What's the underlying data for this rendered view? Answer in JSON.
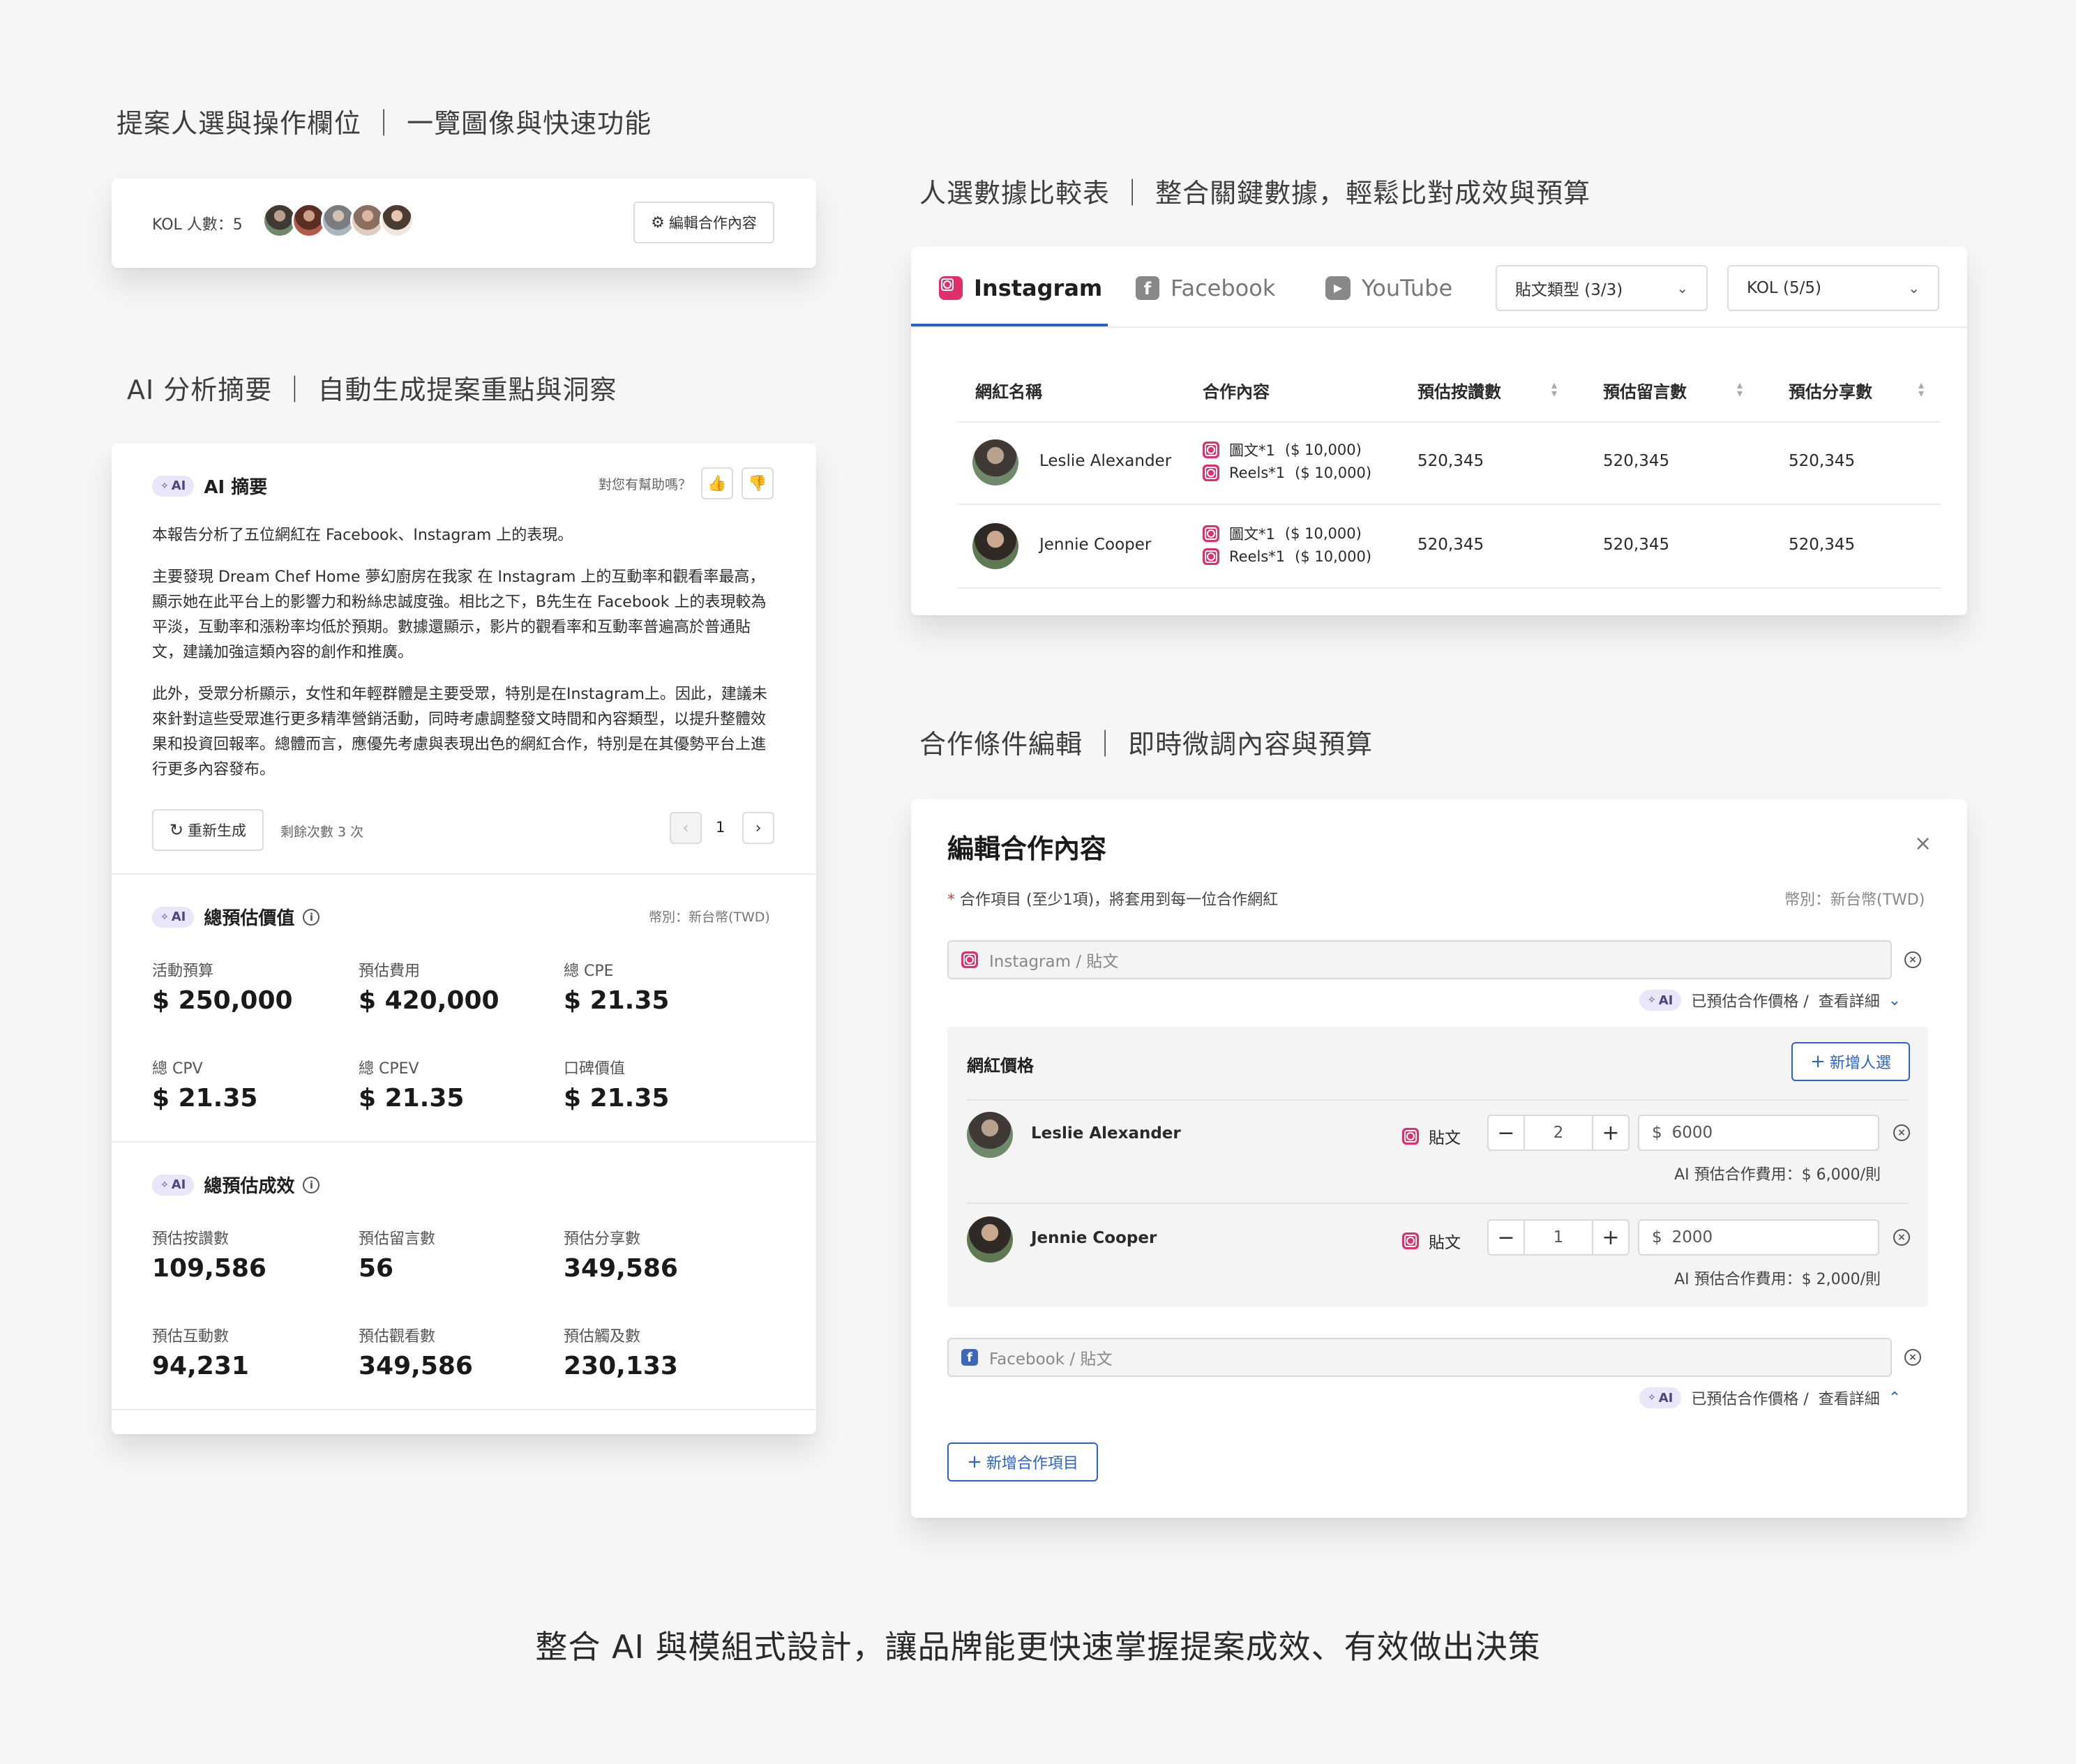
{
  "headings": {
    "kol": "提案人選與操作欄位 ｜ 一覽圖像與快速功能",
    "ai": "AI 分析摘要 ｜ 自動生成提案重點與洞察",
    "compare": "人選數據比較表 ｜ 整合關鍵數據，輕鬆比對成效與預算",
    "edit": "合作條件編輯 ｜ 即時微調內容與預算",
    "footer": "整合 AI 與模組式設計，讓品牌能更快速掌握提案成效、有效做出決策"
  },
  "kol_bar": {
    "count_label": "KOL 人數：5",
    "edit_button": "編輯合作內容"
  },
  "ai_summary": {
    "badge": "AI",
    "title": "AI 摘要",
    "helpful": "對您有幫助嗎？",
    "p1": "本報告分析了五位網紅在 Facebook、Instagram 上的表現。",
    "p2": "主要發現 Dream Chef Home 夢幻廚房在我家 在 Instagram 上的互動率和觀看率最高，顯示她在此平台上的影響力和粉絲忠誠度強。相比之下，B先生在 Facebook 上的表現較為平淡，互動率和漲粉率均低於預期。數據還顯示，影片的觀看率和互動率普遍高於普通貼文，建議加強這類內容的創作和推廣。",
    "p3": "此外，受眾分析顯示，女性和年輕群體是主要受眾，特別是在Instagram上。因此，建議未來針對這些受眾進行更多精準營銷活動，同時考慮調整發文時間和內容類型，以提升整體效果和投資回報率。總體而言，應優先考慮與表現出色的網紅合作，特別是在其優勢平台上進行更多內容發布。",
    "regen": "重新生成",
    "remaining": "剩餘次數 3 次",
    "page": "1"
  },
  "total_value": {
    "badge": "AI",
    "title": "總預估價值",
    "currency": "幣別：新台幣(TWD)",
    "items": [
      {
        "label": "活動預算",
        "value": "$ 250,000"
      },
      {
        "label": "預估費用",
        "value": "$ 420,000"
      },
      {
        "label": "總 CPE",
        "value": "$ 21.35"
      },
      {
        "label": "總 CPV",
        "value": "$ 21.35"
      },
      {
        "label": "總 CPEV",
        "value": "$ 21.35"
      },
      {
        "label": "口碑價值",
        "value": "$ 21.35"
      }
    ]
  },
  "total_effect": {
    "badge": "AI",
    "title": "總預估成效",
    "items": [
      {
        "label": "預估按讚數",
        "value": "109,586"
      },
      {
        "label": "預估留言數",
        "value": "56"
      },
      {
        "label": "預估分享數",
        "value": "349,586"
      },
      {
        "label": "預估互動數",
        "value": "94,231"
      },
      {
        "label": "預估觀看數",
        "value": "349,586"
      },
      {
        "label": "預估觸及數",
        "value": "230,133"
      }
    ]
  },
  "compare": {
    "tabs": [
      "Instagram",
      "Facebook",
      "YouTube"
    ],
    "filter_type": "貼文類型 (3/3)",
    "filter_kol": "KOL  (5/5)",
    "columns": [
      "網紅名稱",
      "合作內容",
      "預估按讚數",
      "預估留言數",
      "預估分享數"
    ],
    "rows": [
      {
        "name": "Leslie Alexander",
        "c1": "圖文*1",
        "p1": "($ 10,000)",
        "c2": "Reels*1",
        "p2": "($ 10,000)",
        "likes": "520,345",
        "comments": "520,345",
        "shares": "520,345"
      },
      {
        "name": "Jennie Cooper",
        "c1": "圖文*1",
        "p1": "($ 10,000)",
        "c2": "Reels*1",
        "p2": "($ 10,000)",
        "likes": "520,345",
        "comments": "520,345",
        "shares": "520,345"
      }
    ]
  },
  "edit": {
    "title": "編輯合作內容",
    "required_note": "合作項目 (至少1項)，將套用到每一位合作網紅",
    "currency": "幣別：新台幣(TWD)",
    "item1_placeholder": "Instagram / 貼文",
    "item2_placeholder": "Facebook / 貼文",
    "ai_badge": "AI",
    "estimated": "已預估合作價格 /",
    "details": "查看詳細",
    "price_section": "網紅價格",
    "add_kol": "新增人選",
    "post_label": "貼文",
    "kols": [
      {
        "name": "Leslie Alexander",
        "qty": "2",
        "price": "6000",
        "ai_fee": "AI 預估合作費用：$ 6,000/則"
      },
      {
        "name": "Jennie Cooper",
        "qty": "1",
        "price": "2000",
        "ai_fee": "AI 預估合作費用：$ 2,000/則"
      }
    ],
    "add_item": "新增合作項目"
  }
}
